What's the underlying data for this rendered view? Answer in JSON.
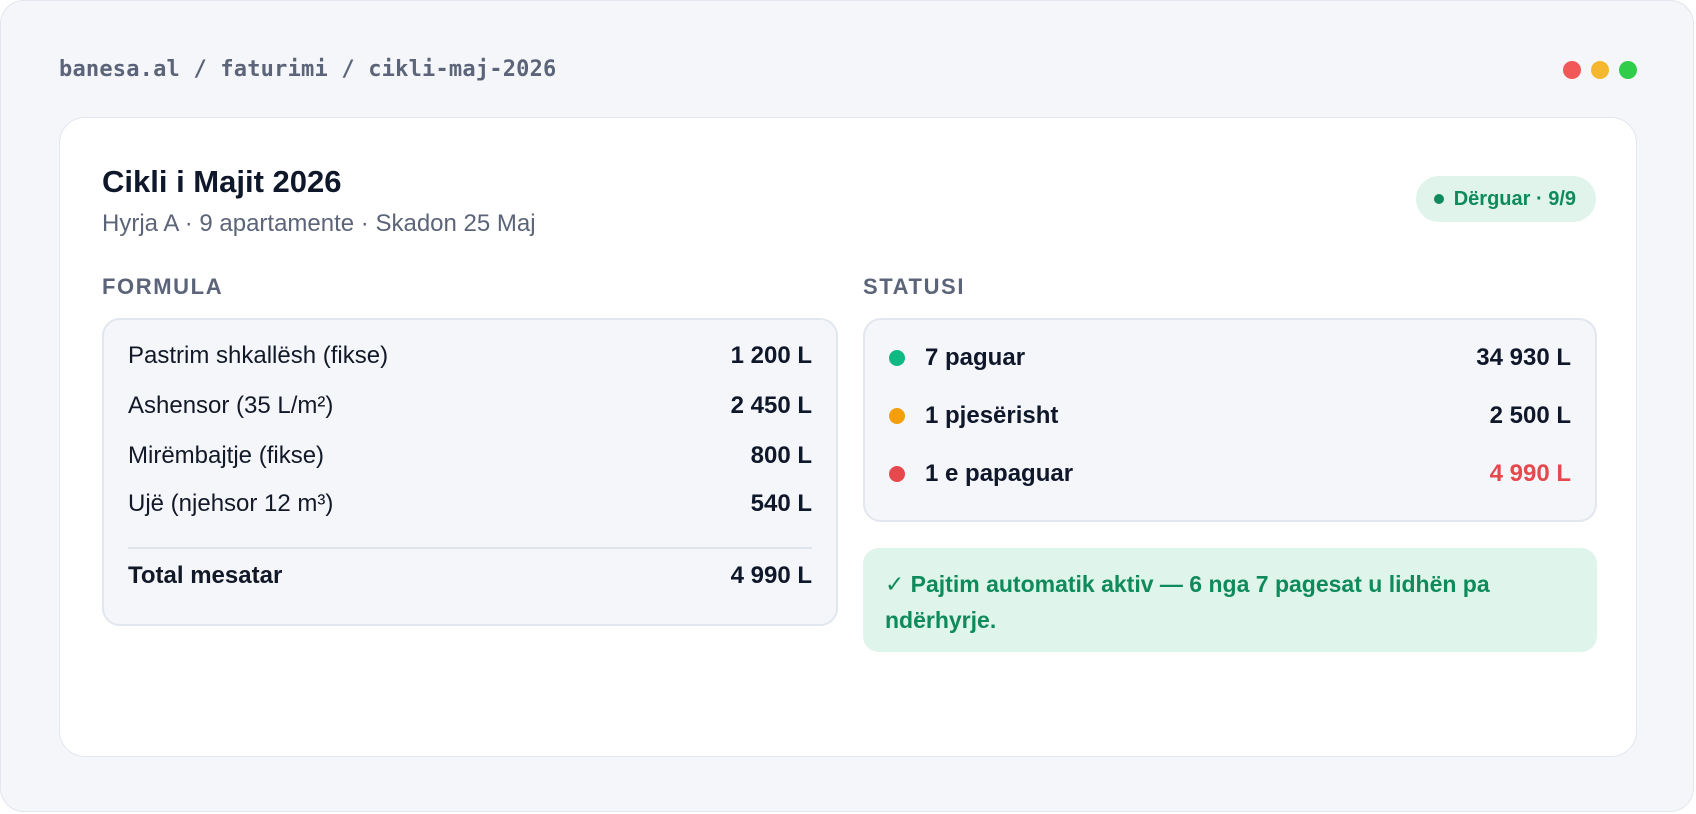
{
  "breadcrumb": "banesa.al / faturimi / cikli-maj-2026",
  "card": {
    "title": "Cikli i Majit 2026",
    "subtitle": "Hyrja A · 9 apartamente · Skadon 25 Maj",
    "badge": "Dërguar · 9/9"
  },
  "formula": {
    "section_label": "FORMULA",
    "rows": [
      {
        "label": "Pastrim shkallësh (fikse)",
        "value": "1 200 L"
      },
      {
        "label": "Ashensor (35 L/m²)",
        "value": "2 450 L"
      },
      {
        "label": "Mirëmbajtje (fikse)",
        "value": "800 L"
      },
      {
        "label": "Ujë (njehsor 12 m³)",
        "value": "540 L"
      }
    ],
    "total": {
      "label": "Total mesatar",
      "value": "4 990 L"
    }
  },
  "status": {
    "section_label": "STATUSI",
    "rows": [
      {
        "label": "7 paguar",
        "value": "34 930 L",
        "color": "#10b981"
      },
      {
        "label": "1 pjesërisht",
        "value": "2 500 L",
        "color": "#f59e0b"
      },
      {
        "label": "1 e papaguar",
        "value": "4 990 L",
        "color": "#e5484d"
      }
    ]
  },
  "notice": "✓ Pajtim automatik aktiv — 6 nga 7 pagesat u lidhën pa ndërhyrje."
}
